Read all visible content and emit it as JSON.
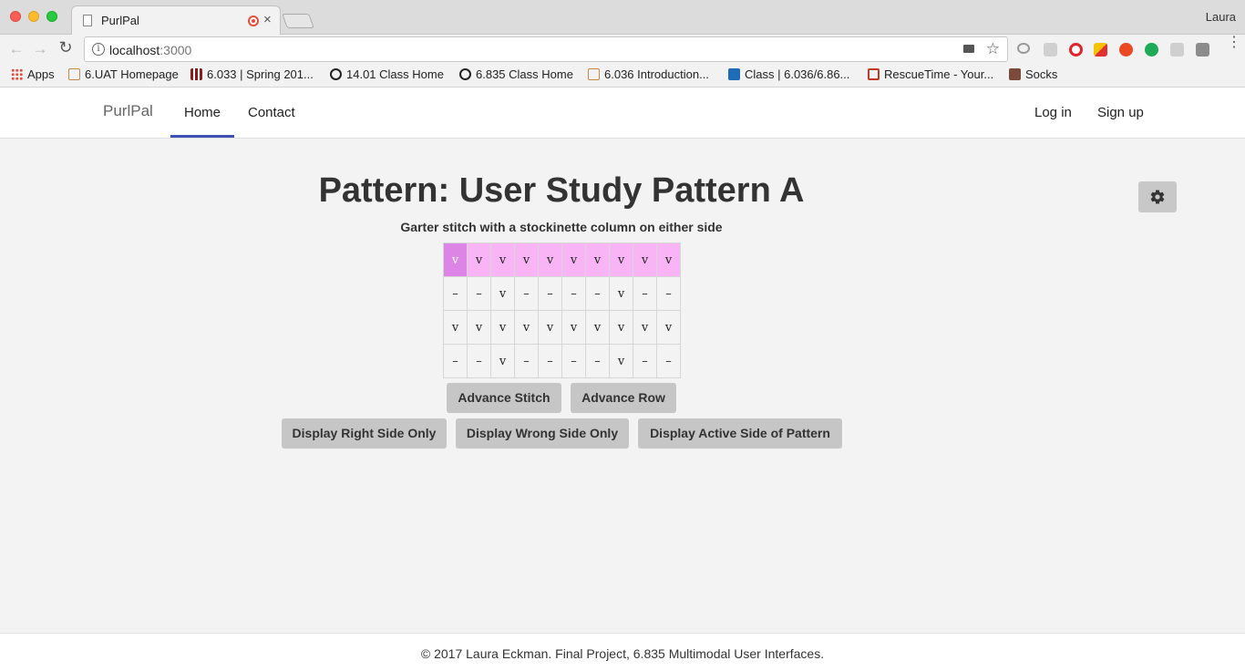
{
  "browser": {
    "tab_title": "PurlPal",
    "tab_close": "×",
    "user_name": "Laura",
    "url_host": "localhost",
    "url_port": ":3000",
    "url_info": "i",
    "star": "☆",
    "back": "←",
    "forward": "→",
    "reload": "↻",
    "menu": "⋮",
    "bookmarks": [
      {
        "label": "Apps",
        "icon": "apps-grid-icon",
        "color": "#e74c3c"
      },
      {
        "label": "6.UAT Homepage",
        "icon": "document-icon",
        "color": "#c8884a"
      },
      {
        "label": "6.033 | Spring 201...",
        "icon": "mit-logo-icon",
        "color": "#8b1a1a"
      },
      {
        "label": "14.01 Class Home",
        "icon": "stellar-icon",
        "color": "#222222"
      },
      {
        "label": "6.835 Class Home",
        "icon": "stellar-icon",
        "color": "#222222"
      },
      {
        "label": "6.036 Introduction...",
        "icon": "document-icon",
        "color": "#c8884a"
      },
      {
        "label": "Class | 6.036/6.86...",
        "icon": "lm-icon",
        "color": "#1e6bb8"
      },
      {
        "label": "RescueTime - Your...",
        "icon": "rescuetime-icon",
        "color": "#c0392b"
      },
      {
        "label": "Socks",
        "icon": "photo-icon",
        "color": "#7a4a3a"
      }
    ]
  },
  "nav": {
    "brand": "PurlPal",
    "home": "Home",
    "contact": "Contact",
    "login": "Log in",
    "signup": "Sign up"
  },
  "main": {
    "title": "Pattern: User Study Pattern A",
    "subtitle": "Garter stitch with a stockinette column on either side",
    "pattern_rows": [
      [
        "v",
        "v",
        "v",
        "v",
        "v",
        "v",
        "v",
        "v",
        "v",
        "v"
      ],
      [
        "–",
        "–",
        "v",
        "–",
        "–",
        "–",
        "–",
        "v",
        "–",
        "–"
      ],
      [
        "v",
        "v",
        "v",
        "v",
        "v",
        "v",
        "v",
        "v",
        "v",
        "v"
      ],
      [
        "–",
        "–",
        "v",
        "–",
        "–",
        "–",
        "–",
        "v",
        "–",
        "–"
      ]
    ],
    "active_row": 0,
    "active_stitch": 0,
    "buttons": {
      "advance_stitch": "Advance Stitch",
      "advance_row": "Advance Row",
      "right_side": "Display Right Side Only",
      "wrong_side": "Display Wrong Side Only",
      "active_side": "Display Active Side of Pattern"
    }
  },
  "footer": {
    "text": "© 2017 Laura Eckman. Final Project, 6.835 Multimodal User Interfaces."
  },
  "colors": {
    "active_row": "#f8b4f4",
    "active_stitch": "#dd85e6",
    "nav_underline": "#3f51b5",
    "button": "#c6c6c6"
  }
}
